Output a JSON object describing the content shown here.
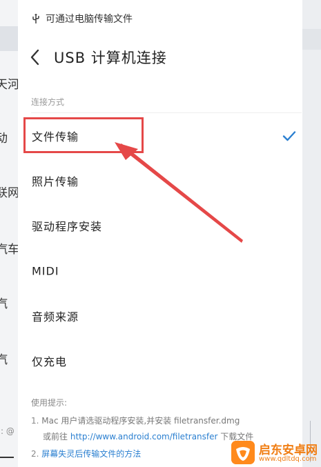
{
  "background_app": {
    "fragments": [
      "天河",
      "动",
      "联网",
      "汽车",
      "汽",
      "汽"
    ],
    "side_text": ": @"
  },
  "status_bar": {
    "icon": "usb-icon",
    "text": "可通过电脑传输文件"
  },
  "header": {
    "back_icon": "chevron-left-icon",
    "title": "USB 计算机连接"
  },
  "section": {
    "label": "连接方式"
  },
  "options": [
    {
      "label": "文件传输",
      "selected": true
    },
    {
      "label": "照片传输",
      "selected": false
    },
    {
      "label": "驱动程序安装",
      "selected": false
    },
    {
      "label": "MIDI",
      "selected": false
    },
    {
      "label": "音频来源",
      "selected": false
    },
    {
      "label": "仅充电",
      "selected": false
    }
  ],
  "check_icon": "check-icon",
  "hints": {
    "title": "使用提示:",
    "item1_num": "1.",
    "item1_text": "Mac 用户请选驱动程序安装,并安装 filetransfer.dmg",
    "item1b_prefix": "或前往",
    "item1b_link": "http://www.android.com/filetransfer",
    "item1b_suffix": "下载文件",
    "item2_num": "2.",
    "item2_link": "屏幕失灵后传输文件的方法"
  },
  "annotation": {
    "box_color": "#e54848",
    "arrow_color": "#e54848"
  },
  "watermark": {
    "name": "启东安卓网",
    "url": "www.qdltdq.com",
    "color": "#f07d12"
  },
  "colors": {
    "link": "#2a7fd0",
    "check": "#2a7fd0"
  }
}
